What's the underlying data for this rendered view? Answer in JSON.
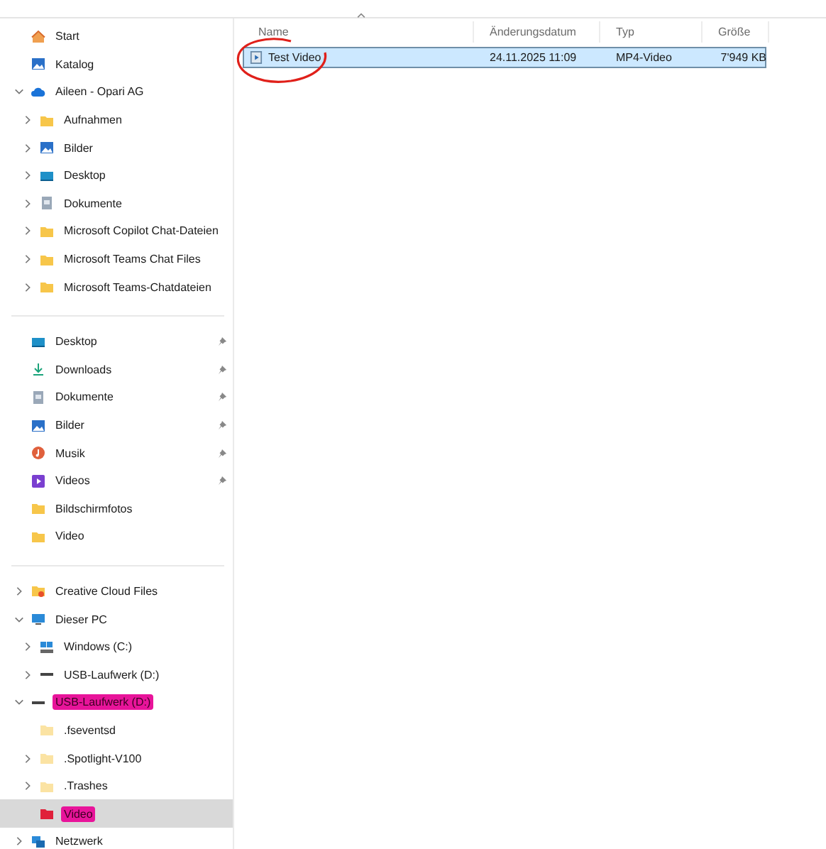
{
  "sidebar": {
    "sections": [
      {
        "items": [
          {
            "label": "Start",
            "kind": "home",
            "selected": false,
            "highlighted": false
          },
          {
            "label": "Katalog",
            "kind": "gallery",
            "selected": false,
            "highlighted": false
          },
          {
            "label": "Aileen - Opari AG",
            "kind": "cloud",
            "expanded": true,
            "selected": false,
            "highlighted": false,
            "children": [
              {
                "label": "Aufnahmen",
                "kind": "folder",
                "expanded": false,
                "selected": false,
                "highlighted": false
              },
              {
                "label": "Bilder",
                "kind": "pictures",
                "expanded": false,
                "selected": false,
                "highlighted": false
              },
              {
                "label": "Desktop",
                "kind": "desktop",
                "expanded": false,
                "selected": false,
                "highlighted": false
              },
              {
                "label": "Dokumente",
                "kind": "documents",
                "expanded": false,
                "selected": false,
                "highlighted": false
              },
              {
                "label": "Microsoft Copilot Chat-Dateien",
                "kind": "folder",
                "expanded": false,
                "selected": false,
                "highlighted": false
              },
              {
                "label": "Microsoft Teams Chat Files",
                "kind": "folder",
                "expanded": false,
                "selected": false,
                "highlighted": false
              },
              {
                "label": "Microsoft Teams-Chatdateien",
                "kind": "folder",
                "expanded": false,
                "selected": false,
                "highlighted": false
              }
            ]
          }
        ]
      },
      {
        "items": [
          {
            "label": "Desktop",
            "kind": "desktop",
            "pinned": true,
            "selected": false,
            "highlighted": false
          },
          {
            "label": "Downloads",
            "kind": "downloads",
            "pinned": true,
            "selected": false,
            "highlighted": false
          },
          {
            "label": "Dokumente",
            "kind": "documents",
            "pinned": true,
            "selected": false,
            "highlighted": false
          },
          {
            "label": "Bilder",
            "kind": "pictures",
            "pinned": true,
            "selected": false,
            "highlighted": false
          },
          {
            "label": "Musik",
            "kind": "music",
            "pinned": true,
            "selected": false,
            "highlighted": false
          },
          {
            "label": "Videos",
            "kind": "videos",
            "pinned": true,
            "selected": false,
            "highlighted": false
          },
          {
            "label": "Bildschirmfotos",
            "kind": "folder",
            "pinned": false,
            "selected": false,
            "highlighted": false
          },
          {
            "label": "Video",
            "kind": "folder",
            "pinned": false,
            "selected": false,
            "highlighted": false
          }
        ]
      },
      {
        "items": [
          {
            "label": "Creative Cloud Files",
            "kind": "cc-folder",
            "expanded": false,
            "selected": false,
            "highlighted": false
          },
          {
            "label": "Dieser PC",
            "kind": "pc",
            "expanded": true,
            "selected": false,
            "highlighted": false,
            "children": [
              {
                "label": "Windows (C:)",
                "kind": "windows-drive",
                "expanded": false,
                "selected": false,
                "highlighted": false
              },
              {
                "label": "USB-Laufwerk (D:)",
                "kind": "usb",
                "expanded": false,
                "selected": false,
                "highlighted": false
              }
            ]
          },
          {
            "label": "USB-Laufwerk (D:)",
            "kind": "usb",
            "expanded": true,
            "selected": false,
            "highlighted": true,
            "children": [
              {
                "label": ".fseventsd",
                "kind": "pale-folder",
                "selected": false,
                "highlighted": false
              },
              {
                "label": ".Spotlight-V100",
                "kind": "pale-folder",
                "expanded": false,
                "selected": false,
                "highlighted": false
              },
              {
                "label": ".Trashes",
                "kind": "pale-folder",
                "expanded": false,
                "selected": false,
                "highlighted": false
              },
              {
                "label": "Video",
                "kind": "red-folder",
                "selected": true,
                "highlighted": true
              }
            ]
          },
          {
            "label": "Netzwerk",
            "kind": "network",
            "expanded": false,
            "selected": false,
            "highlighted": false
          }
        ]
      }
    ]
  },
  "file_list": {
    "sort_indicator": true,
    "columns": [
      "Name",
      "Änderungsdatum",
      "Typ",
      "Größe"
    ],
    "rows": [
      {
        "name": "Test Video",
        "modified": "24.11.2025 11:09",
        "type": "MP4-Video",
        "size": "7'949 KB",
        "selected": true,
        "circled": true
      }
    ]
  }
}
